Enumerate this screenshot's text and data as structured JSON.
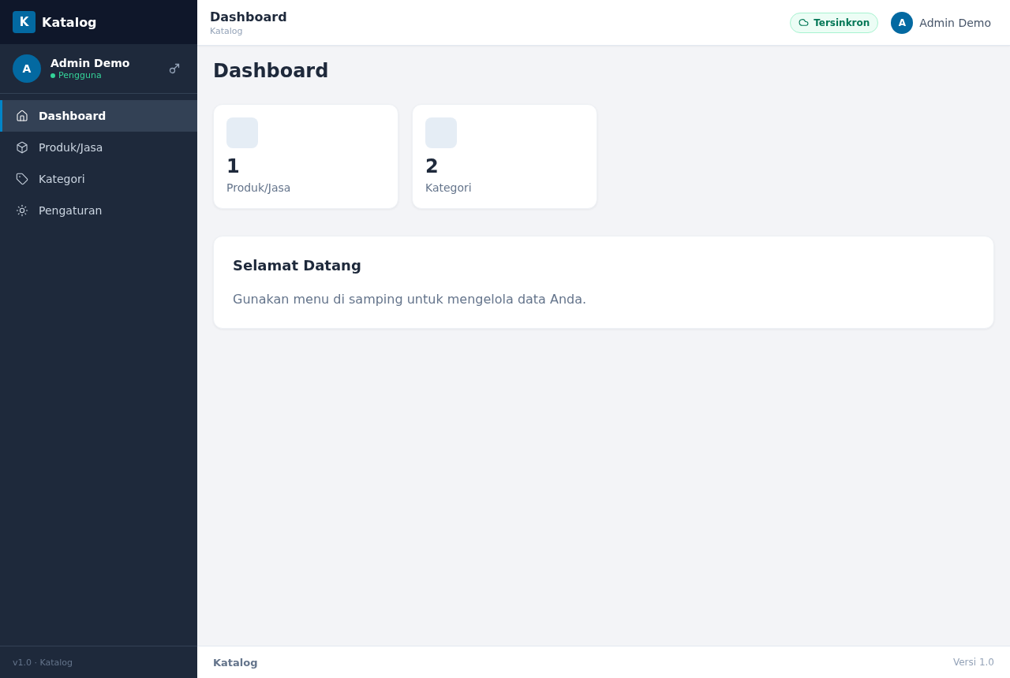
{
  "sidebar": {
    "brand": {
      "logo_letter": "K",
      "name": "Katalog"
    },
    "user": {
      "avatar_letter": "A",
      "name": "Admin Demo",
      "role": "Pengguna",
      "online": true
    },
    "nav": [
      {
        "label": "Dashboard",
        "selected": true
      },
      {
        "label": "Produk/Jasa",
        "selected": false
      },
      {
        "label": "Kategori",
        "selected": false
      },
      {
        "label": "Pengaturan",
        "selected": false
      }
    ],
    "footer": "v1.0 · Katalog"
  },
  "header": {
    "title": "Dashboard",
    "subtitle": "Katalog",
    "sync_badge": "Tersinkron",
    "user": {
      "avatar_letter": "A",
      "name": "Admin Demo"
    }
  },
  "page": {
    "heading": "Dashboard",
    "stats": [
      {
        "value": "1",
        "label": "Produk/Jasa"
      },
      {
        "value": "2",
        "label": "Kategori"
      }
    ],
    "welcome": {
      "title": "Selamat Datang",
      "text": "Gunakan menu di samping untuk mengelola data Anda."
    }
  },
  "footer": {
    "left": "Katalog",
    "right": "Versi 1.0"
  }
}
